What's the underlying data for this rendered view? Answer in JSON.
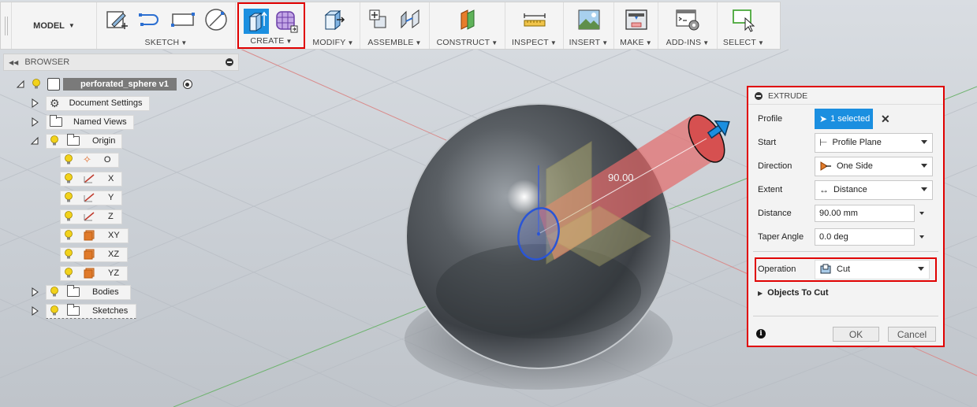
{
  "toolbar": {
    "model_label": "MODEL",
    "groups": [
      {
        "label": "SKETCH"
      },
      {
        "label": "CREATE"
      },
      {
        "label": "MODIFY"
      },
      {
        "label": "ASSEMBLE"
      },
      {
        "label": "CONSTRUCT"
      },
      {
        "label": "INSPECT"
      },
      {
        "label": "INSERT"
      },
      {
        "label": "MAKE"
      },
      {
        "label": "ADD-INS"
      },
      {
        "label": "SELECT"
      }
    ]
  },
  "browser": {
    "title": "BROWSER",
    "root": "perforated_sphere v1",
    "items": [
      {
        "label": "Document Settings"
      },
      {
        "label": "Named Views"
      },
      {
        "label": "Origin"
      },
      {
        "label": "O"
      },
      {
        "label": "X"
      },
      {
        "label": "Y"
      },
      {
        "label": "Z"
      },
      {
        "label": "XY"
      },
      {
        "label": "XZ"
      },
      {
        "label": "YZ"
      },
      {
        "label": "Bodies"
      },
      {
        "label": "Sketches"
      }
    ]
  },
  "viewport": {
    "dimension_label": "90.00"
  },
  "extrude": {
    "title": "EXTRUDE",
    "profile_label": "Profile",
    "profile_value": "1 selected",
    "start_label": "Start",
    "start_value": "Profile Plane",
    "direction_label": "Direction",
    "direction_value": "One Side",
    "extent_label": "Extent",
    "extent_value": "Distance",
    "distance_label": "Distance",
    "distance_value": "90.00 mm",
    "taper_label": "Taper Angle",
    "taper_value": "0.0 deg",
    "operation_label": "Operation",
    "operation_value": "Cut",
    "objects_to_cut": "Objects To Cut",
    "ok": "OK",
    "cancel": "Cancel"
  },
  "colors": {
    "accent_blue": "#1b8fe0",
    "highlight_red": "#e00000",
    "bulb_yellow": "#f2d21b"
  }
}
